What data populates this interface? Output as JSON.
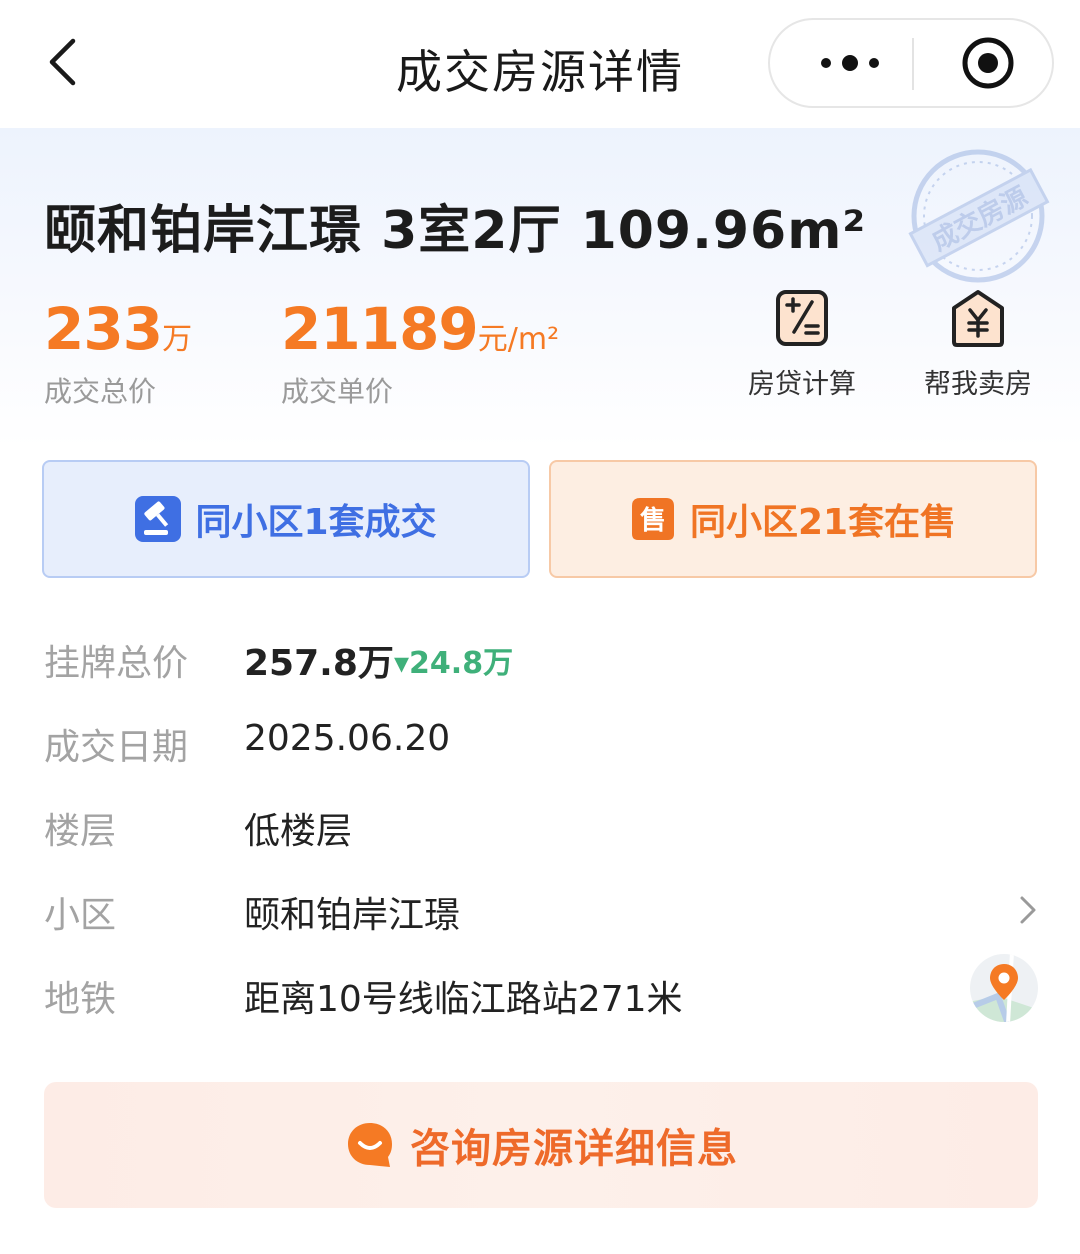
{
  "nav": {
    "title": "成交房源详情"
  },
  "listing": {
    "title": "颐和铂岸江璟 3室2厅 109.96m²",
    "stamp_text": "成交房源",
    "total_price": {
      "value": "233",
      "unit": "万",
      "label": "成交总价"
    },
    "unit_price": {
      "value": "21189",
      "unit": "元/m²",
      "label": "成交单价"
    }
  },
  "tools": [
    {
      "label": "房贷计算",
      "icon": "calculator-icon"
    },
    {
      "label": "帮我卖房",
      "icon": "sell-house-icon"
    }
  ],
  "community_buttons": {
    "deal": {
      "label": "同小区1套成交",
      "icon": "gavel-icon"
    },
    "sale": {
      "label": "同小区21套在售",
      "icon": "sale-tag-icon",
      "icon_text": "售"
    }
  },
  "details": {
    "list_price": {
      "label": "挂牌总价",
      "value": "257.8万",
      "delta": "▾24.8万"
    },
    "deal_date": {
      "label": "成交日期",
      "value": "2025.06.20"
    },
    "floor": {
      "label": "楼层",
      "value": "低楼层"
    },
    "community": {
      "label": "小区",
      "value": "颐和铂岸江璟"
    },
    "subway": {
      "label": "地铁",
      "value": "距离10号线临江路站271米"
    }
  },
  "consult": {
    "label": "咨询房源详细信息",
    "icon": "chat-bubble-icon"
  },
  "colors": {
    "price_orange": "#f57a24",
    "deal_blue": "#3f6fe3",
    "drop_green": "#3fb07a"
  }
}
